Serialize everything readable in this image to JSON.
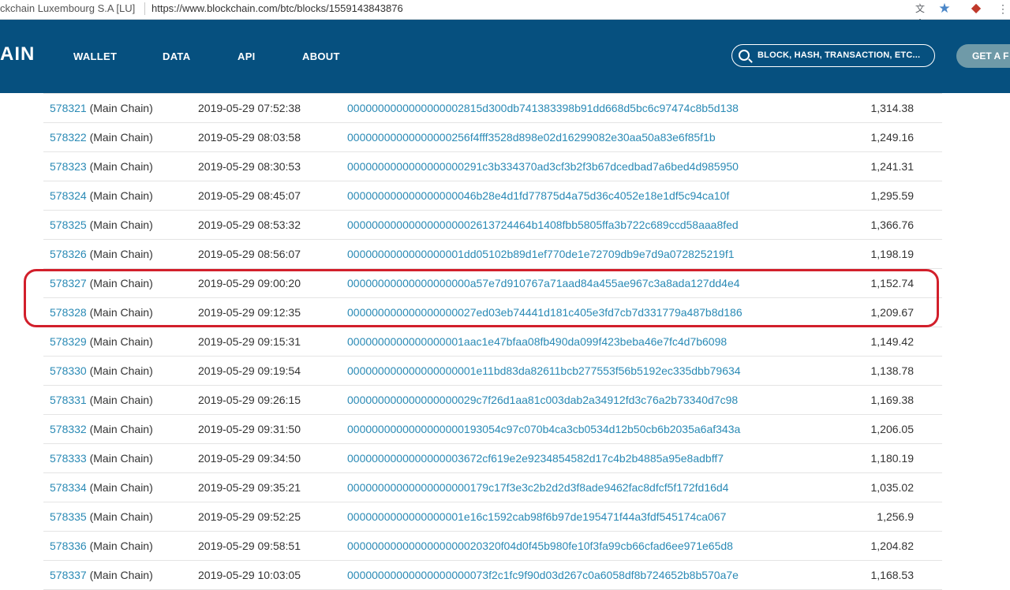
{
  "browser": {
    "origin": "ckchain Luxembourg S.A [LU]",
    "url": "https://www.blockchain.com/btc/blocks/1559143843876"
  },
  "header": {
    "brand": "AIN",
    "nav": [
      "WALLET",
      "DATA",
      "API",
      "ABOUT"
    ],
    "search_placeholder": "BLOCK, HASH, TRANSACTION, ETC...",
    "cta": "GET A F"
  },
  "table": {
    "chain_label": "(Main Chain)",
    "rows": [
      {
        "height": "578321",
        "time": "2019-05-29 07:52:38",
        "hash": "0000000000000000002815d300db741383398b91dd668d5bc6c97474c8b5d138",
        "size": "1,314.38"
      },
      {
        "height": "578322",
        "time": "2019-05-29 08:03:58",
        "hash": "00000000000000000256f4fff3528d898e02d16299082e30aa50a83e6f85f1b",
        "size": "1,249.16"
      },
      {
        "height": "578323",
        "time": "2019-05-29 08:30:53",
        "hash": "0000000000000000000291c3b334370ad3cf3b2f3b67dcedbad7a6bed4d985950",
        "size": "1,241.31"
      },
      {
        "height": "578324",
        "time": "2019-05-29 08:45:07",
        "hash": "000000000000000000046b28e4d1fd77875d4a75d36c4052e18e1df5c94ca10f",
        "size": "1,295.59"
      },
      {
        "height": "578325",
        "time": "2019-05-29 08:53:32",
        "hash": "000000000000000000002613724464b1408fbb5805ffa3b722c689ccd58aaa8fed",
        "size": "1,366.76"
      },
      {
        "height": "578326",
        "time": "2019-05-29 08:56:07",
        "hash": "0000000000000000001dd05102b89d1ef770de1e72709db9e7d9a072825219f1",
        "size": "1,198.19"
      },
      {
        "height": "578327",
        "time": "2019-05-29 09:00:20",
        "hash": "00000000000000000000a57e7d910767a71aad84a455ae967c3a8ada127dd4e4",
        "size": "1,152.74"
      },
      {
        "height": "578328",
        "time": "2019-05-29 09:12:35",
        "hash": "000000000000000000027ed03eb74441d181c405e3fd7cb7d331779a487b8d186",
        "size": "1,209.67"
      },
      {
        "height": "578329",
        "time": "2019-05-29 09:15:31",
        "hash": "0000000000000000001aac1e47bfaa08fb490da099f423beba46e7fc4d7b6098",
        "size": "1,149.42"
      },
      {
        "height": "578330",
        "time": "2019-05-29 09:19:54",
        "hash": "000000000000000000001e11bd83da82611bcb277553f56b5192ec335dbb79634",
        "size": "1,138.78"
      },
      {
        "height": "578331",
        "time": "2019-05-29 09:26:15",
        "hash": "000000000000000000029c7f26d1aa81c003dab2a34912fd3c76a2b73340d7c98",
        "size": "1,169.38"
      },
      {
        "height": "578332",
        "time": "2019-05-29 09:31:50",
        "hash": "0000000000000000000193054c97c070b4ca3cb0534d12b50cb6b2035a6af343a",
        "size": "1,206.05"
      },
      {
        "height": "578333",
        "time": "2019-05-29 09:34:50",
        "hash": "0000000000000000003672cf619e2e9234854582d17c4b2b4885a95e8adbff7",
        "size": "1,180.19"
      },
      {
        "height": "578334",
        "time": "2019-05-29 09:35:21",
        "hash": "00000000000000000000179c17f3e3c2b2d2d3f8ade9462fac8dfcf5f172fd16d4",
        "size": "1,035.02"
      },
      {
        "height": "578335",
        "time": "2019-05-29 09:52:25",
        "hash": "0000000000000000001e16c1592cab98f6b97de195471f44a3fdf545174ca067",
        "size": "1,256.9"
      },
      {
        "height": "578336",
        "time": "2019-05-29 09:58:51",
        "hash": "0000000000000000000020320f04d0f45b980fe10f3fa99cb66cfad6ee971e65d8",
        "size": "1,204.82"
      },
      {
        "height": "578337",
        "time": "2019-05-29 10:03:05",
        "hash": "00000000000000000000073f2c1fc9f90d03d267c0a6058df8b724652b8b570a7e",
        "size": "1,168.53"
      }
    ]
  },
  "icons": {
    "translate": "translate-icon",
    "bookmark": "star-icon",
    "extension": "extension-icon",
    "menu": "menu-icon"
  },
  "colors": {
    "header_bg": "#06507f",
    "link": "#2a8ab5",
    "highlight": "#d21f2b"
  }
}
